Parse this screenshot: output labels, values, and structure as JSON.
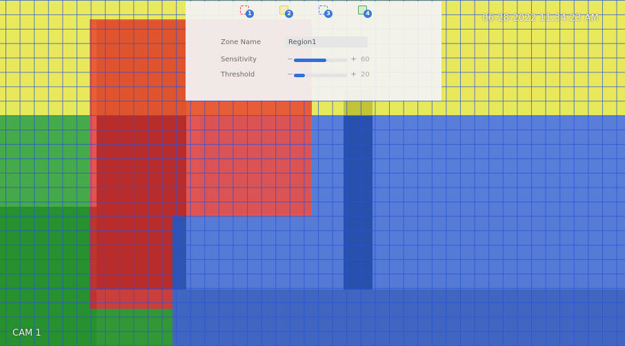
{
  "overlay": {
    "timestamp": "06-28-2022 11:34:23 AM",
    "camera_label": "CAM 1"
  },
  "zone_tabs": [
    {
      "number": "1",
      "color": "#e03a3a"
    },
    {
      "number": "2",
      "color": "#e6d34a"
    },
    {
      "number": "3",
      "color": "#3b79d6"
    },
    {
      "number": "4",
      "color": "#3fb04a"
    }
  ],
  "settings": {
    "zone_name_label": "Zone Name",
    "zone_name_value": "Region1",
    "sensitivity_label": "Sensitivity",
    "sensitivity_minus": "−",
    "sensitivity_plus": "+",
    "sensitivity_value": "60",
    "sensitivity_fraction": 0.6,
    "threshold_label": "Threshold",
    "threshold_minus": "−",
    "threshold_plus": "+",
    "threshold_value": "20",
    "threshold_fraction": 0.2
  },
  "zone_colors": {
    "zone_1": "#e82828",
    "zone_2": "#eeee3c",
    "zone_3": "#285fe1",
    "zone_4": "#1ea028"
  }
}
